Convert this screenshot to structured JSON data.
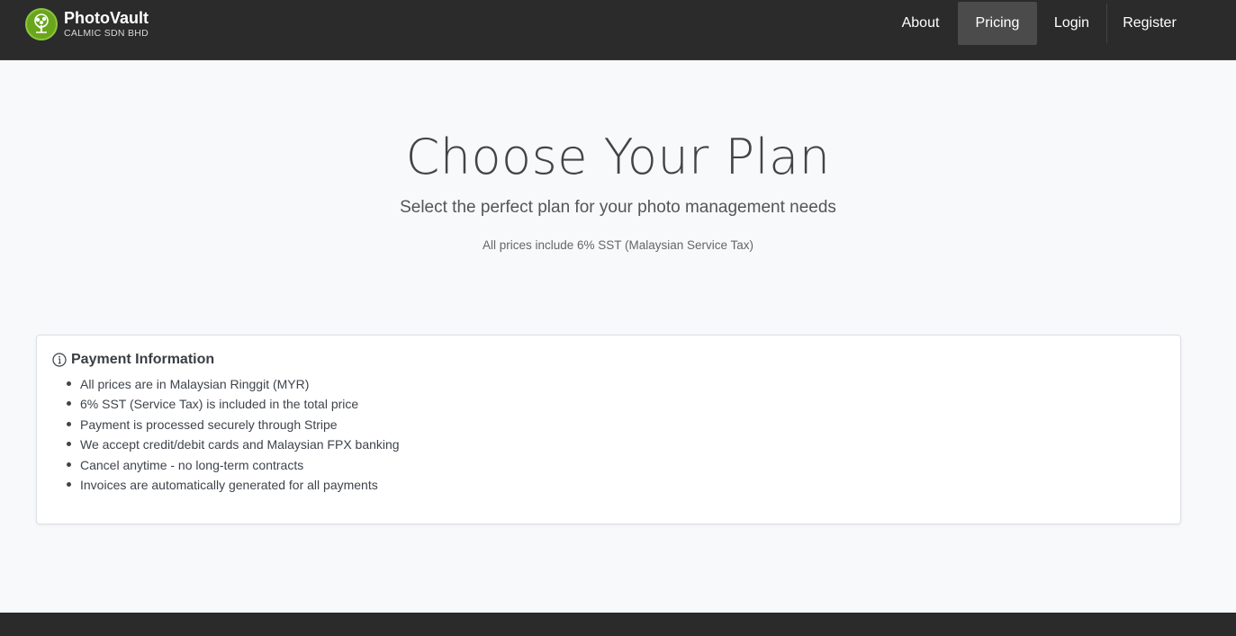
{
  "brand": {
    "name": "PhotoVault",
    "subtitle": "CALMIC SDN BHD",
    "logo_icon": "tree-icon",
    "accent": "#6aa61c"
  },
  "nav": {
    "items": [
      {
        "label": "About",
        "active": false
      },
      {
        "label": "Pricing",
        "active": true
      },
      {
        "label": "Login",
        "active": false
      },
      {
        "label": "Register",
        "active": false
      }
    ]
  },
  "hero": {
    "title": "Choose Your Plan",
    "subtitle": "Select the perfect plan for your photo management needs",
    "note": "All prices include 6% SST (Malaysian Service Tax)"
  },
  "payment_info": {
    "title": "Payment Information",
    "icon": "info-icon",
    "items": [
      "All prices are in Malaysian Ringgit (MYR)",
      "6% SST (Service Tax) is included in the total price",
      "Payment is processed securely through Stripe",
      "We accept credit/debit cards and Malaysian FPX banking",
      "Cancel anytime - no long-term contracts",
      "Invoices are automatically generated for all payments"
    ]
  },
  "colors": {
    "navbar_bg": "#2b2b2b",
    "page_bg": "#f8f9fb"
  }
}
